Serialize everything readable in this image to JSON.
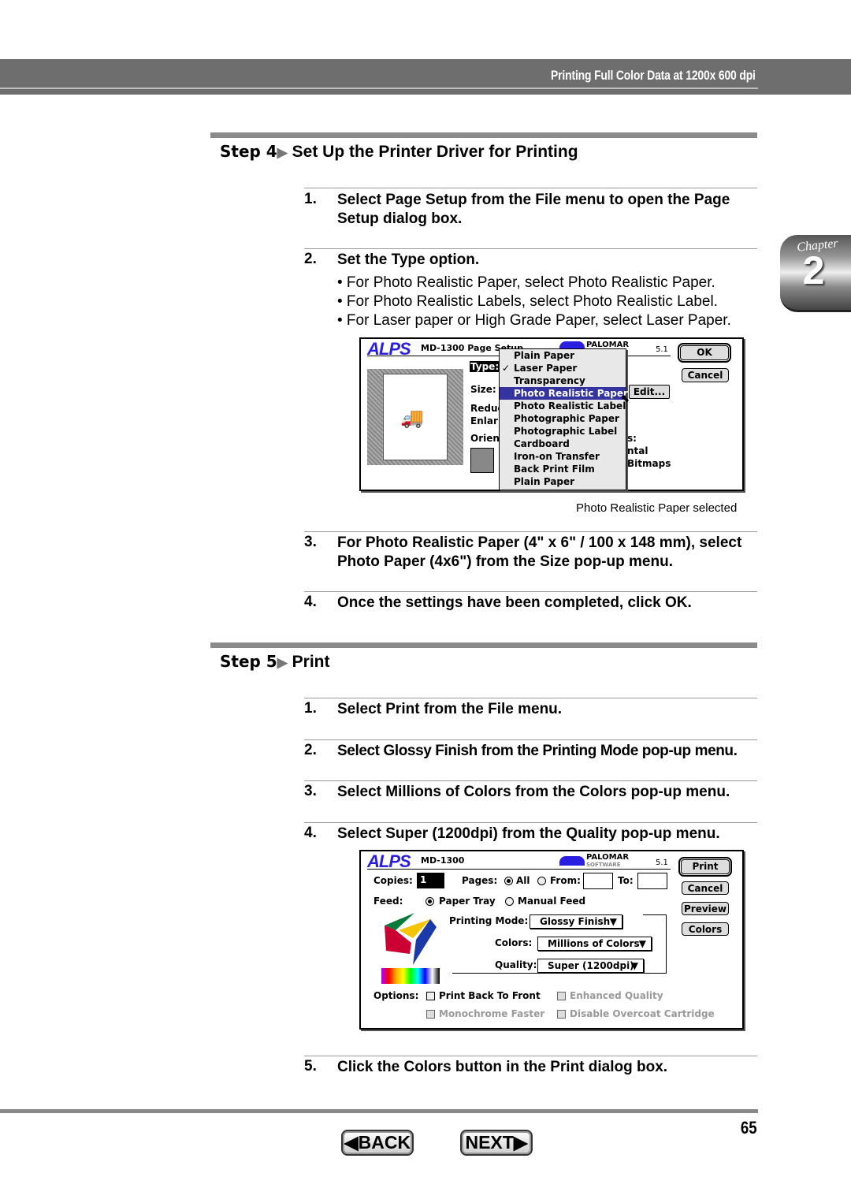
{
  "header": {
    "title": "Printing Full Color Data at 1200x 600 dpi"
  },
  "chapter_tab": {
    "label": "Chapter",
    "number": "2"
  },
  "step4": {
    "label": "Step 4",
    "title": "Set Up the Printer Driver for Printing",
    "items": [
      {
        "num": "1.",
        "text": "Select Page Setup from the File menu to open the Page Setup dialog box."
      },
      {
        "num": "2.",
        "text": "Set the Type option.",
        "bullets": [
          "• For Photo Realistic Paper, select Photo Realistic Paper.",
          "• For Photo Realistic Labels, select Photo Realistic Label.",
          "• For Laser paper or High Grade Paper, select Laser Paper."
        ]
      },
      {
        "num": "3.",
        "text": "For Photo Realistic Paper (4\" x 6\" / 100 x 148 mm), select Photo Paper (4x6\") from the Size pop-up menu."
      },
      {
        "num": "4.",
        "text": "Once the settings have been completed, click OK."
      }
    ],
    "caption": "Photo Realistic Paper selected"
  },
  "page_setup": {
    "brand": "ALPS",
    "title": "MD-1300 Page Setup",
    "vendor": "PALOMAR",
    "version": "5.1",
    "ok": "OK",
    "cancel": "Cancel",
    "edit": "Edit...",
    "type_label": "Type:",
    "size_label": "Size:",
    "reduce_label": "Reduc",
    "enlarge_label": "Enlar",
    "orient_label": "Orien",
    "partial1": "s:",
    "partial2": "ntal",
    "partial3": "Bitmaps",
    "menu": [
      "Plain Paper",
      "Laser Paper",
      "Transparency",
      "Photo Realistic Paper",
      "Photo Realistic Label",
      "Photographic Paper",
      "Photographic Label",
      "Cardboard",
      "Iron-on Transfer",
      "Back Print Film",
      "Plain Paper"
    ],
    "checked": "Laser Paper",
    "highlighted": "Photo Realistic Paper",
    "highlight_color": "#3434a0"
  },
  "step5": {
    "label": "Step 5",
    "title": "Print",
    "items": [
      {
        "num": "1.",
        "text": "Select Print from the File menu."
      },
      {
        "num": "2.",
        "text": "Select Glossy Finish from the Printing Mode pop-up menu."
      },
      {
        "num": "3.",
        "text": "Select Millions of Colors from the Colors pop-up menu."
      },
      {
        "num": "4.",
        "text": "Select Super (1200dpi) from the Quality pop-up menu."
      },
      {
        "num": "5.",
        "text": "Click the Colors button in the Print dialog box."
      }
    ]
  },
  "print_dialog": {
    "brand": "ALPS",
    "title": "MD-1300",
    "vendor": "PALOMAR",
    "vendor_sub": "SOFTWARE",
    "version": "5.1",
    "print": "Print",
    "cancel": "Cancel",
    "preview": "Preview",
    "colors_btn": "Colors",
    "copies_label": "Copies:",
    "copies_value": "1",
    "pages_label": "Pages:",
    "all": "All",
    "from": "From:",
    "to": "To:",
    "from_value": "",
    "to_value": "",
    "feed_label": "Feed:",
    "paper_tray": "Paper Tray",
    "manual_feed": "Manual Feed",
    "mode_label": "Printing Mode:",
    "mode_value": "Glossy Finish",
    "colors_label": "Colors:",
    "colors_value": "Millions of Colors",
    "quality_label": "Quality:",
    "quality_value": "Super (1200dpi)",
    "options_label": "Options:",
    "opt1": "Print Back To Front",
    "opt2": "Enhanced Quality",
    "opt3": "Monochrome Faster",
    "opt4": "Disable Overcoat Cartridge"
  },
  "footer": {
    "back": "◀BACK",
    "next": "NEXT▶",
    "page": "65"
  }
}
